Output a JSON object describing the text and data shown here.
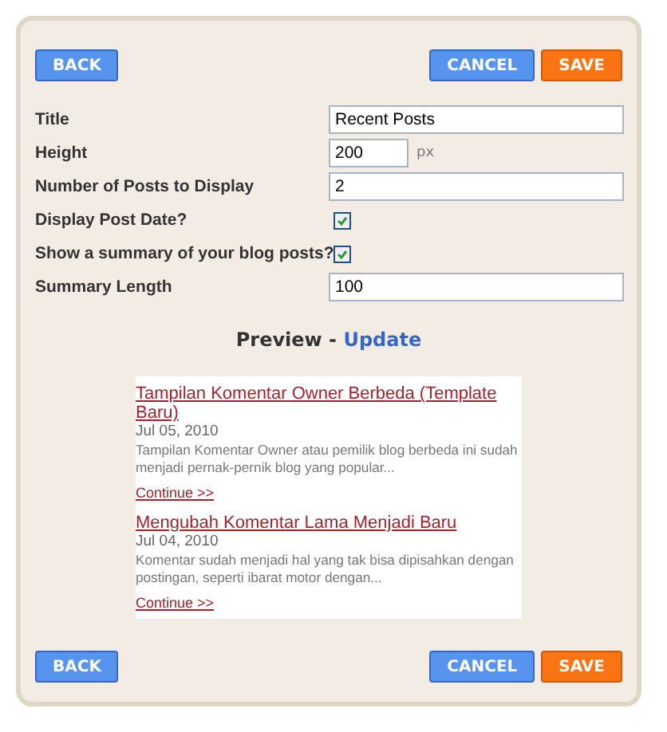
{
  "top_buttons": [
    {
      "label": "BACK",
      "kind": "secondary"
    },
    {
      "label": "CANCEL",
      "kind": "secondary"
    },
    {
      "label": "SAVE",
      "kind": "primary"
    }
  ],
  "fields": [
    {
      "kind": "text",
      "label": "Title",
      "value": "Recent Posts"
    },
    {
      "kind": "short",
      "label": "Height",
      "value": "200",
      "unit": "px"
    },
    {
      "kind": "text",
      "label": "Number of Posts to Display",
      "value": "2"
    },
    {
      "kind": "checkbox",
      "label": "Display Post Date?",
      "checked": true
    },
    {
      "kind": "checkbox",
      "label": "Show a summary of your blog posts?",
      "checked": true
    },
    {
      "kind": "text",
      "label": "Summary Length",
      "value": "100"
    }
  ],
  "preview": {
    "heading": "Preview - ",
    "link": "Update",
    "posts": [
      {
        "title": "Tampilan Komentar Owner Berbeda (Template Baru)",
        "date": "Jul 05, 2010",
        "summary": "Tampilan Komentar Owner atau pemilik blog berbeda ini sudah menjadi pernak-pernik blog yang popular...",
        "more": "Continue >>"
      },
      {
        "title": "Mengubah Komentar Lama Menjadi Baru",
        "date": "Jul 04, 2010",
        "summary": "Komentar sudah menjadi hal yang tak bisa dipisahkan dengan postingan, seperti ibarat motor dengan...",
        "more": "Continue >>"
      }
    ]
  },
  "bottom_buttons": [
    {
      "label": "BACK",
      "kind": "secondary"
    },
    {
      "label": "CANCEL",
      "kind": "secondary"
    },
    {
      "label": "SAVE",
      "kind": "primary"
    }
  ]
}
